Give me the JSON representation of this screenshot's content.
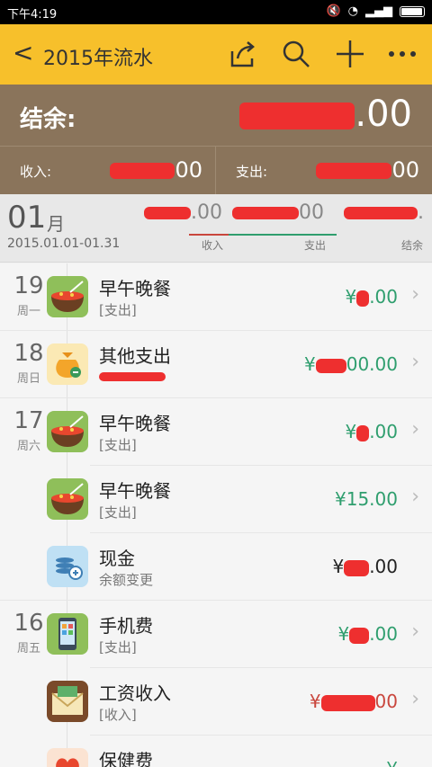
{
  "status": {
    "time": "下午4:19"
  },
  "header": {
    "back_symbol": "<",
    "title": "2015年流水"
  },
  "balance": {
    "label": "结余:",
    "amount_tail": ".00"
  },
  "summary": {
    "income_label": "收入:",
    "income_tail": "00",
    "expense_label": "支出:",
    "expense_tail": "00"
  },
  "month": {
    "number": "01",
    "unit": "月",
    "range": "2015.01.01-01.31",
    "income_tail": ".00",
    "expense_tail": "00",
    "balance_tail": ".",
    "income_label": "收入",
    "expense_label": "支出",
    "balance_label": "结余"
  },
  "entries": [
    {
      "day": "19",
      "weekday": "周一",
      "name": "早午晚餐",
      "sub": "[支出]",
      "amount_head": "¥",
      "amount_tail": ".00",
      "color": "#2f9e6e",
      "icon": "meal-icon"
    },
    {
      "day": "18",
      "weekday": "周日",
      "name": "其他支出",
      "sub": "",
      "amount_head": "¥",
      "amount_tail": "00.00",
      "color": "#2f9e6e",
      "icon": "money-bag-icon"
    },
    {
      "day": "17",
      "weekday": "周六",
      "name": "早午晚餐",
      "sub": "[支出]",
      "amount_head": "¥",
      "amount_tail": ".00",
      "color": "#2f9e6e",
      "icon": "meal-icon"
    },
    {
      "day": "",
      "weekday": "",
      "name": "早午晚餐",
      "sub": "[支出]",
      "amount_head": "¥",
      "amount_tail": "15.00",
      "color": "#2f9e6e",
      "icon": "meal-icon"
    },
    {
      "day": "",
      "weekday": "",
      "name": "现金",
      "sub": "余额变更",
      "amount_head": "¥",
      "amount_tail": ".00",
      "color": "#222222",
      "icon": "cash-icon"
    },
    {
      "day": "16",
      "weekday": "周五",
      "name": "手机费",
      "sub": "[支出]",
      "amount_head": "¥",
      "amount_tail": ".00",
      "color": "#2f9e6e",
      "icon": "phone-icon"
    },
    {
      "day": "",
      "weekday": "",
      "name": "工资收入",
      "sub": "[收入]",
      "amount_head": "¥",
      "amount_tail": "00",
      "color": "#c9463d",
      "icon": "salary-envelope-icon"
    },
    {
      "day": "",
      "weekday": "",
      "name": "保健费",
      "sub": "",
      "amount_head": "¥",
      "amount_tail": "",
      "color": "#2f9e6e",
      "icon": "health-icon"
    }
  ]
}
